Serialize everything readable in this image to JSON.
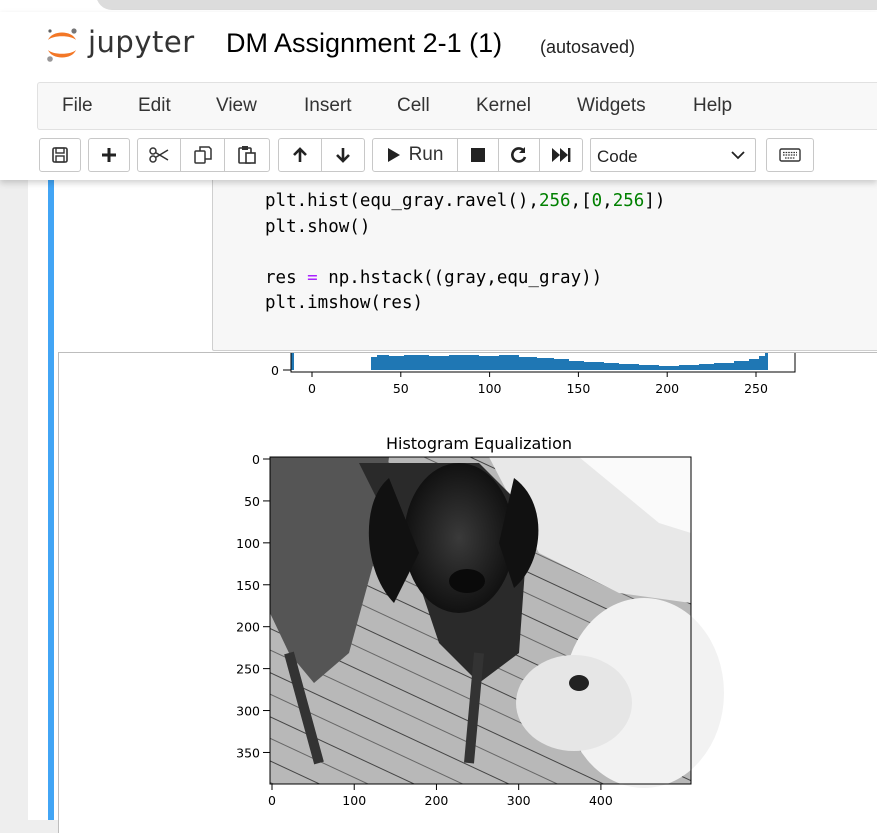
{
  "header": {
    "logo_text": "jupyter",
    "notebook_title": "DM Assignment 2-1 (1)",
    "save_status": "(autosaved)"
  },
  "menu": [
    "File",
    "Edit",
    "View",
    "Insert",
    "Cell",
    "Kernel",
    "Widgets",
    "Help"
  ],
  "toolbar": {
    "save_icon": "floppy-icon",
    "insert_icon": "plus-icon",
    "cut_icon": "scissors-icon",
    "copy_icon": "copy-icon",
    "paste_icon": "paste-icon",
    "move_up_icon": "arrow-up-icon",
    "move_down_icon": "arrow-down-icon",
    "run_label": "Run",
    "interrupt_icon": "stop-icon",
    "restart_icon": "restart-icon",
    "run_all_icon": "fast-forward-icon",
    "cell_type": "Code",
    "keyboard_icon": "keyboard-icon"
  },
  "code": [
    {
      "a": "plt.hist(equ_gray.ravel(),",
      "n1": "256",
      "b": ",[",
      "n2": "0",
      "c": ",",
      "n3": "256",
      "d": "])"
    },
    {
      "a": "plt.show()"
    },
    {
      "a": ""
    },
    {
      "a": "res ",
      "op": "=",
      "b": " np.hstack((gray,equ_gray))"
    },
    {
      "a": "plt.imshow(res)"
    }
  ],
  "colors": {
    "cell_marker": "#42a5f5",
    "hist_bar": "#1f77b4"
  },
  "histogram_axis": {
    "y_tick": "0",
    "x_ticks": [
      "0",
      "50",
      "100",
      "150",
      "200",
      "250"
    ]
  },
  "image_plot": {
    "title": "Histogram Equalization",
    "y_ticks": [
      "0",
      "50",
      "100",
      "150",
      "200",
      "250",
      "300",
      "350"
    ],
    "x_ticks": [
      "0",
      "100",
      "200",
      "300",
      "400"
    ]
  },
  "chart_data": [
    {
      "type": "bar",
      "x": [
        0,
        50,
        100,
        150,
        200,
        250
      ],
      "xlim": [
        -15,
        270
      ],
      "xticks": [
        0,
        50,
        100,
        150,
        200,
        250
      ],
      "yticks": [
        0
      ]
    },
    {
      "type": "heatmap",
      "title": "Histogram Equalization",
      "xticks": [
        0,
        100,
        200,
        300,
        400
      ],
      "yticks": [
        0,
        50,
        100,
        150,
        200,
        250,
        300,
        350
      ]
    }
  ]
}
